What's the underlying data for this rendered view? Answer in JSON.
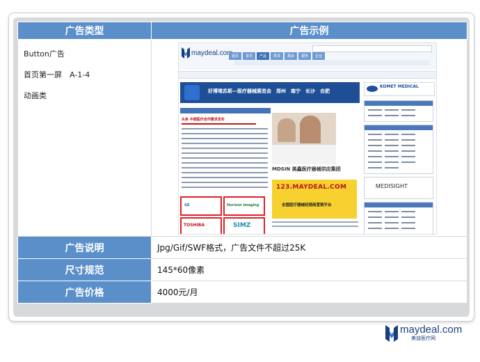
{
  "table": {
    "col_type_header": "广告类型",
    "col_example_header": "广告示例",
    "type_lines": [
      "Button广告",
      "首页第一屏　A-1-4",
      "动画类"
    ],
    "rows": [
      {
        "label": "广告说明",
        "value": "Jpg/Gif/SWF格式，广告文件不超过25K"
      },
      {
        "label": "尺寸规范",
        "value": "145*60像素"
      },
      {
        "label": "广告价格",
        "value": "4000元/月"
      }
    ]
  },
  "example": {
    "site_logo": "maydeal.com",
    "nav": [
      "首页",
      "资讯",
      "产品",
      "供求",
      "展会",
      "服务",
      "企业"
    ],
    "banner_text": "好博塔苏斯—医疗器械展览会　郑州　南宁　长沙　合肥",
    "komet_text": "KOMET MEDICAL",
    "red_title": "头条 中德医疗合作需求发布",
    "mdsin_text": "MDSIN 美鑫医疗器械供应集团",
    "yellow_title": "123.MAYDEAL.COM",
    "yellow_sub": "全国医疗器械经销商营销平台",
    "medisight_text": "MEDISIGHT",
    "ads": [
      "GE",
      "Horizon Imaging",
      "TOSHIBA",
      "SIMZ"
    ]
  },
  "footer": {
    "brand_name": "maydeal.com",
    "brand_sub": "美迪医疗网"
  },
  "colors": {
    "header_blue": "#5b8fca",
    "panel_gray": "#d8d9dc",
    "brand_blue": "#1a3f7a"
  }
}
